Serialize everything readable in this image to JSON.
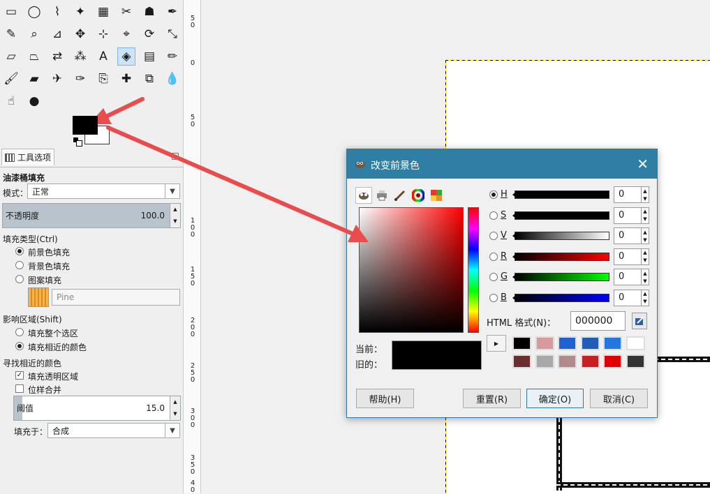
{
  "toolbox": {
    "tools": [
      {
        "name": "rect-select-icon",
        "glyph": "▭"
      },
      {
        "name": "ellipse-select-icon",
        "glyph": "◯"
      },
      {
        "name": "free-select-icon",
        "glyph": "⌇"
      },
      {
        "name": "fuzzy-select-icon",
        "glyph": "✦"
      },
      {
        "name": "select-by-color-icon",
        "glyph": "▦"
      },
      {
        "name": "scissors-select-icon",
        "glyph": "✂"
      },
      {
        "name": "foreground-select-icon",
        "glyph": "☗"
      },
      {
        "name": "paths-icon",
        "glyph": "✒"
      },
      {
        "name": "color-picker-icon",
        "glyph": "✎"
      },
      {
        "name": "zoom-icon",
        "glyph": "⌕"
      },
      {
        "name": "measure-icon",
        "glyph": "⊿"
      },
      {
        "name": "move-icon",
        "glyph": "✥"
      },
      {
        "name": "align-icon",
        "glyph": "⊹"
      },
      {
        "name": "crop-icon",
        "glyph": "⌖"
      },
      {
        "name": "rotate-icon",
        "glyph": "⟳"
      },
      {
        "name": "scale-icon",
        "glyph": "⤡"
      },
      {
        "name": "shear-icon",
        "glyph": "▱"
      },
      {
        "name": "perspective-icon",
        "glyph": "⏢"
      },
      {
        "name": "flip-icon",
        "glyph": "⇄"
      },
      {
        "name": "cage-icon",
        "glyph": "⁂"
      },
      {
        "name": "text-icon",
        "glyph": "A"
      },
      {
        "name": "bucket-fill-icon",
        "glyph": "◈"
      },
      {
        "name": "blend-icon",
        "glyph": "▤"
      },
      {
        "name": "pencil-icon",
        "glyph": "✏"
      },
      {
        "name": "paintbrush-icon",
        "glyph": "🖌"
      },
      {
        "name": "eraser-icon",
        "glyph": "▰"
      },
      {
        "name": "airbrush-icon",
        "glyph": "✈"
      },
      {
        "name": "ink-icon",
        "glyph": "✑"
      },
      {
        "name": "clone-icon",
        "glyph": "⎘"
      },
      {
        "name": "heal-icon",
        "glyph": "✚"
      },
      {
        "name": "perspective-clone-icon",
        "glyph": "⧉"
      },
      {
        "name": "blur-icon",
        "glyph": "💧"
      },
      {
        "name": "smudge-icon",
        "glyph": "☝"
      },
      {
        "name": "dodge-burn-icon",
        "glyph": "●"
      }
    ],
    "tab_label": "工具选项",
    "tool_name": "油漆桶填充",
    "mode_label": "模式：",
    "mode_value": "正常",
    "opacity_label": "不透明度",
    "opacity_value": "100.0",
    "fill_type_label": "填充类型(Ctrl)",
    "fill_fg": "前景色填充",
    "fill_bg": "背景色填充",
    "fill_pattern": "图案填充",
    "pattern_name": "Pine",
    "affect_label": "影响区域(Shift)",
    "affect_whole": "填充整个选区",
    "affect_similar": "填充相近的颜色",
    "find_similar_label": "寻找相近的颜色",
    "fill_transparent": "填充透明区域",
    "sample_merged": "位样合并",
    "threshold_label": "阈值",
    "threshold_value": "15.0",
    "fill_by_label": "填充于：",
    "fill_by_value": "合成"
  },
  "ruler": {
    "labels": [
      "5\n0",
      "0",
      "5\n0",
      "1\n0\n0",
      "1\n5\n0",
      "2\n0\n0",
      "2\n5\n0",
      "3\n0\n0",
      "3\n5\n0",
      "4\n0"
    ]
  },
  "dialog": {
    "title": "改变前景色",
    "close": "✕",
    "channels": [
      {
        "key": "H",
        "value": "0",
        "gradient": "linear-gradient(to right,#000,#000)"
      },
      {
        "key": "S",
        "value": "0",
        "gradient": "linear-gradient(to right,#000,#000)"
      },
      {
        "key": "V",
        "value": "0",
        "gradient": "linear-gradient(to right,#000,#fff)"
      },
      {
        "key": "R",
        "value": "0",
        "gradient": "linear-gradient(to right,#000,#f00)"
      },
      {
        "key": "G",
        "value": "0",
        "gradient": "linear-gradient(to right,#000,#0f0)"
      },
      {
        "key": "B",
        "value": "0",
        "gradient": "linear-gradient(to right,#000,#00f)"
      }
    ],
    "html_label": "HTML 格式(N)：",
    "html_value": "000000",
    "history_colors": [
      "#000000",
      "#d89a9a",
      "#1f63d0",
      "#1f5db8",
      "#2277e0",
      "#ffffff",
      "#6b2e2e",
      "#a8a8a8",
      "#b38a8a",
      "#c62020",
      "#e00000",
      "#333333"
    ],
    "current_label": "当前：",
    "old_label": "旧的：",
    "help_btn": "帮助(H)",
    "reset_btn": "重置(R)",
    "ok_btn": "确定(O)",
    "cancel_btn": "取消(C)"
  },
  "colors": {
    "accent": "#2f7fa4",
    "arrow": "#e84c4c"
  }
}
